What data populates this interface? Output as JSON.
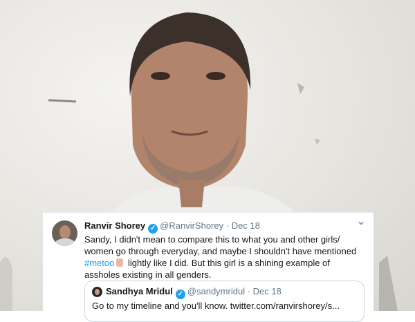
{
  "tweet": {
    "name": "Ranvir Shorey",
    "handle": "@RanvirShorey",
    "sep": "·",
    "date": "Dec 18",
    "text_1": "Sandy, I didn't mean to compare this to what you and other girls/ women go through everyday, and maybe I shouldn't have mentioned ",
    "hashtag": "#metoo",
    "text_2": " lightly like I did. But this girl is a shining example of assholes existing in all genders.",
    "verified_icon": "verified-badge-icon",
    "menu_icon": "chevron-down-icon"
  },
  "quoted": {
    "name": "Sandhya Mridul",
    "handle": "@sandymridul",
    "sep": "·",
    "date": "Dec 18",
    "text": "Go to my timeline and you'll know. twitter.com/ranvirshorey/s..."
  },
  "colors": {
    "link": "#1da1f2",
    "text": "#14171a",
    "muted": "#657786"
  }
}
